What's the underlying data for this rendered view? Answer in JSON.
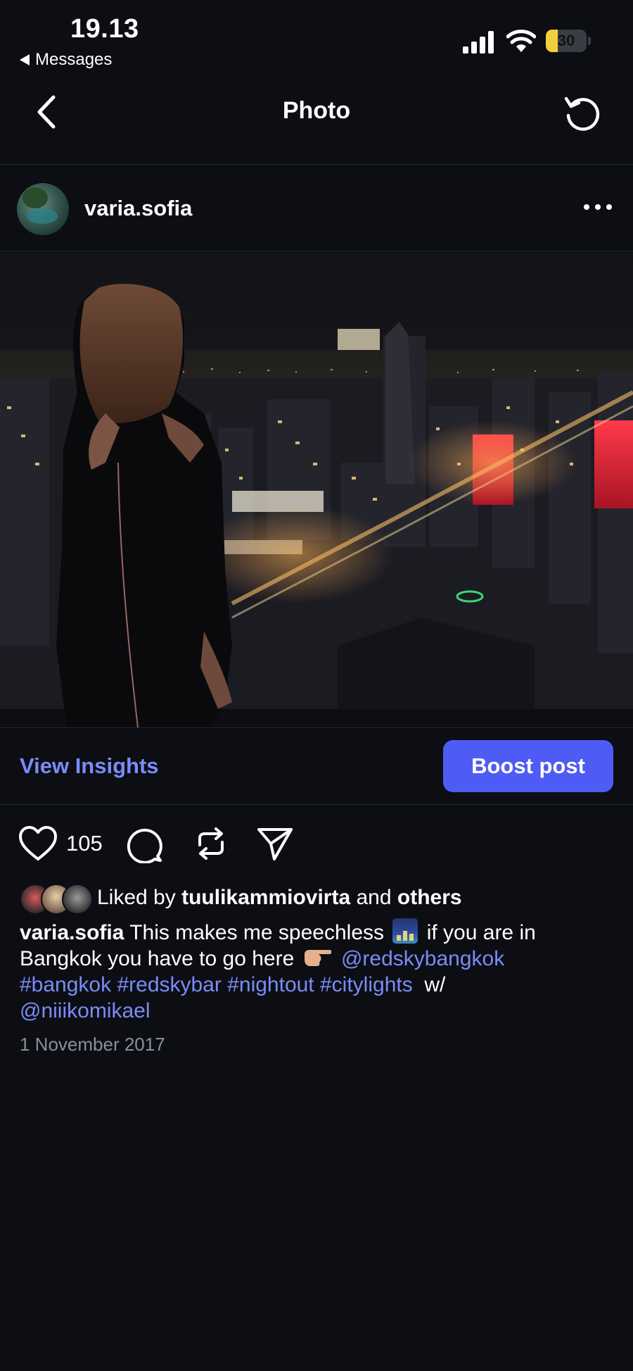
{
  "status_bar": {
    "time": "19.13",
    "back_app": "Messages",
    "battery": "30",
    "battery_level": 0.3
  },
  "nav": {
    "title": "Photo",
    "back_icon": "chevron-left-icon",
    "refresh_icon": "refresh-icon"
  },
  "post": {
    "username": "varia.sofia",
    "more_icon": "ellipsis-icon"
  },
  "insights": {
    "view_label": "View Insights",
    "boost_label": "Boost post"
  },
  "actions": {
    "like_count": "105",
    "icons": [
      "heart-icon",
      "comment-icon",
      "repost-icon",
      "share-icon"
    ]
  },
  "likes": {
    "prefix": "Liked by",
    "user": "tuulikammiovirta",
    "and": "and",
    "others": "others"
  },
  "caption": {
    "username": "varia.sofia",
    "text_1": "This makes me speechless",
    "text_2": "if you are in Bangkok you have to go here",
    "mention_1": "@redskybangkok",
    "tags": [
      "#bangkok",
      "#redskybar",
      "#nightout",
      "#citylights"
    ],
    "with": "w/",
    "mention_2": "@niiikomikael"
  },
  "date": "1 November 2017",
  "colors": {
    "background": "#0c0e14",
    "accent_link": "#7b8cf6",
    "boost_button": "#4e5cf5",
    "muted_text": "#8c8f97"
  }
}
